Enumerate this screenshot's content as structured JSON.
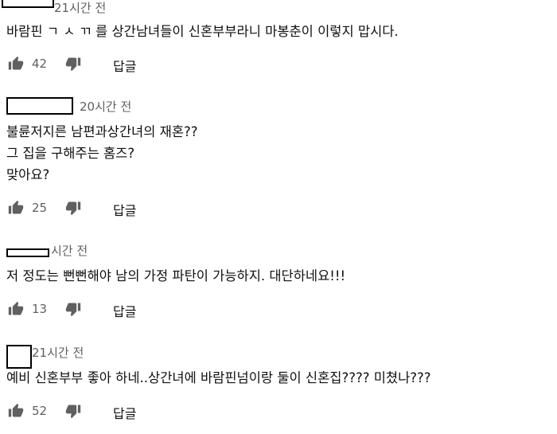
{
  "comments": [
    {
      "time": "21시간 전",
      "body": "바람핀 ㄱ ㅅ ㄲ 를 상간남녀들이 신혼부부라니 마봉춘이 이렇지 맙시다.",
      "likes": "42",
      "reply_label": "답글"
    },
    {
      "time": "20시간 전",
      "body": "불륜저지른 남편과상간녀의 재혼??\n그 집을 구해주는 홈즈?\n맞아요?",
      "likes": "25",
      "reply_label": "답글"
    },
    {
      "time": "시간 전",
      "body": "저 정도는 뻔뻔해야 남의 가정 파탄이 가능하지. 대단하네요!!!",
      "likes": "13",
      "reply_label": "답글"
    },
    {
      "time": "21시간 전",
      "body": "예비 신혼부부 좋아 하네..상간녀에 바람핀넘이랑 둘이 신혼집???? 미쳤나???",
      "likes": "52",
      "reply_label": "답글"
    }
  ],
  "icons": {
    "like": "thumb-up-icon",
    "dislike": "thumb-down-icon"
  },
  "colors": {
    "meta": "#606060",
    "text": "#0f0f0f",
    "icon": "#606060"
  }
}
